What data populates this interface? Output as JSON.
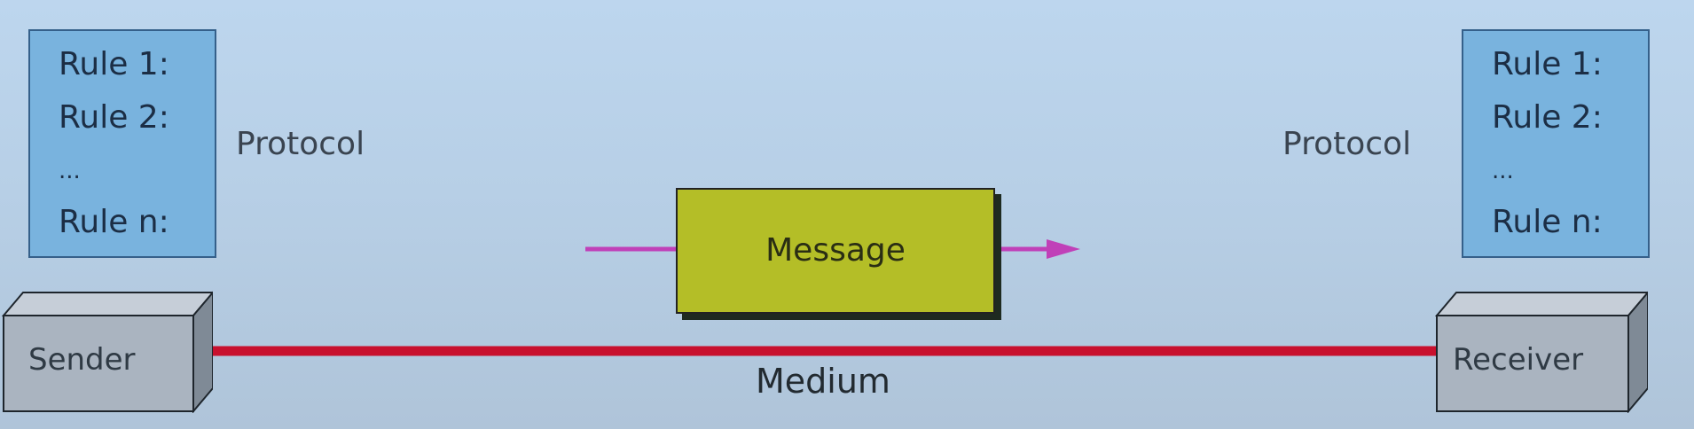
{
  "diagram": {
    "sender_protocol": {
      "rules": [
        "Rule 1:",
        "Rule 2:",
        "...",
        "Rule n:"
      ],
      "label": "Protocol"
    },
    "receiver_protocol": {
      "rules": [
        "Rule 1:",
        "Rule 2:",
        "...",
        "Rule n:"
      ],
      "label": "Protocol"
    },
    "sender": "Sender",
    "receiver": "Receiver",
    "message": "Message",
    "medium": "Medium",
    "colors": {
      "rule_box": "#79b3de",
      "message_box": "#b4be27",
      "medium_line": "#c8102e",
      "arrow": "#c040b8",
      "device": "#aab4c0"
    }
  }
}
